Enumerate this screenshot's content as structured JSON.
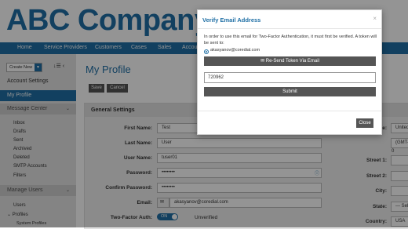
{
  "company": {
    "logo_text": "ABC Company"
  },
  "nav": {
    "items": [
      "Home",
      "Service Providers",
      "Customers",
      "Cases",
      "Sales",
      "Accou"
    ]
  },
  "sidebar": {
    "create_label": "Create New",
    "tools": "↓☰ ‹",
    "items": [
      {
        "label": "Account Settings"
      },
      {
        "label": "My Profile"
      }
    ],
    "message_center": {
      "label": "Message Center",
      "items": [
        "Inbox",
        "Drafts",
        "Sent",
        "Archived",
        "Deleted",
        "SMTP Accounts",
        "Filters"
      ]
    },
    "manage_users": {
      "label": "Manage Users",
      "items": [
        "Users",
        "Profiles",
        "System Profiles"
      ]
    }
  },
  "main": {
    "title": "My Profile",
    "save_label": "Save",
    "cancel_label": "Cancel",
    "general_settings": "General Settings",
    "fields": [
      {
        "label": "First Name:",
        "value": "Test"
      },
      {
        "label": "Last Name:",
        "value": "User"
      },
      {
        "label": "User Name:",
        "value": "tuser01"
      },
      {
        "label": "Password:",
        "value": "••••••••"
      },
      {
        "label": "Confirm Password:",
        "value": "••••••••"
      },
      {
        "label": "Email:",
        "value": "akasyanov@coredial.com"
      }
    ],
    "two_factor": {
      "label": "Two-Factor Auth:",
      "toggle": "ON",
      "status": "Unverified"
    },
    "right_fields": [
      {
        "label": "e:",
        "value": "United"
      },
      {
        "label": "",
        "value": "(GMT-0"
      },
      {
        "label": "Street 1:",
        "value": ""
      },
      {
        "label": "Street 2:",
        "value": ""
      },
      {
        "label": "City:",
        "value": ""
      },
      {
        "label": "State:",
        "value": "--- Sel"
      },
      {
        "label": "Country:",
        "value": "USA"
      }
    ]
  },
  "modal": {
    "title": "Verify Email Address",
    "close_icon": "×",
    "message": "In order to use this email for Two-Factor Authentication, it must first be verified. A token will be sent to:",
    "email_option": "akasyanov@coredial.com",
    "resend_label": "Re-Send Token Via Email",
    "token_value": "720962",
    "submit_label": "Submit",
    "close_label": "Close"
  }
}
